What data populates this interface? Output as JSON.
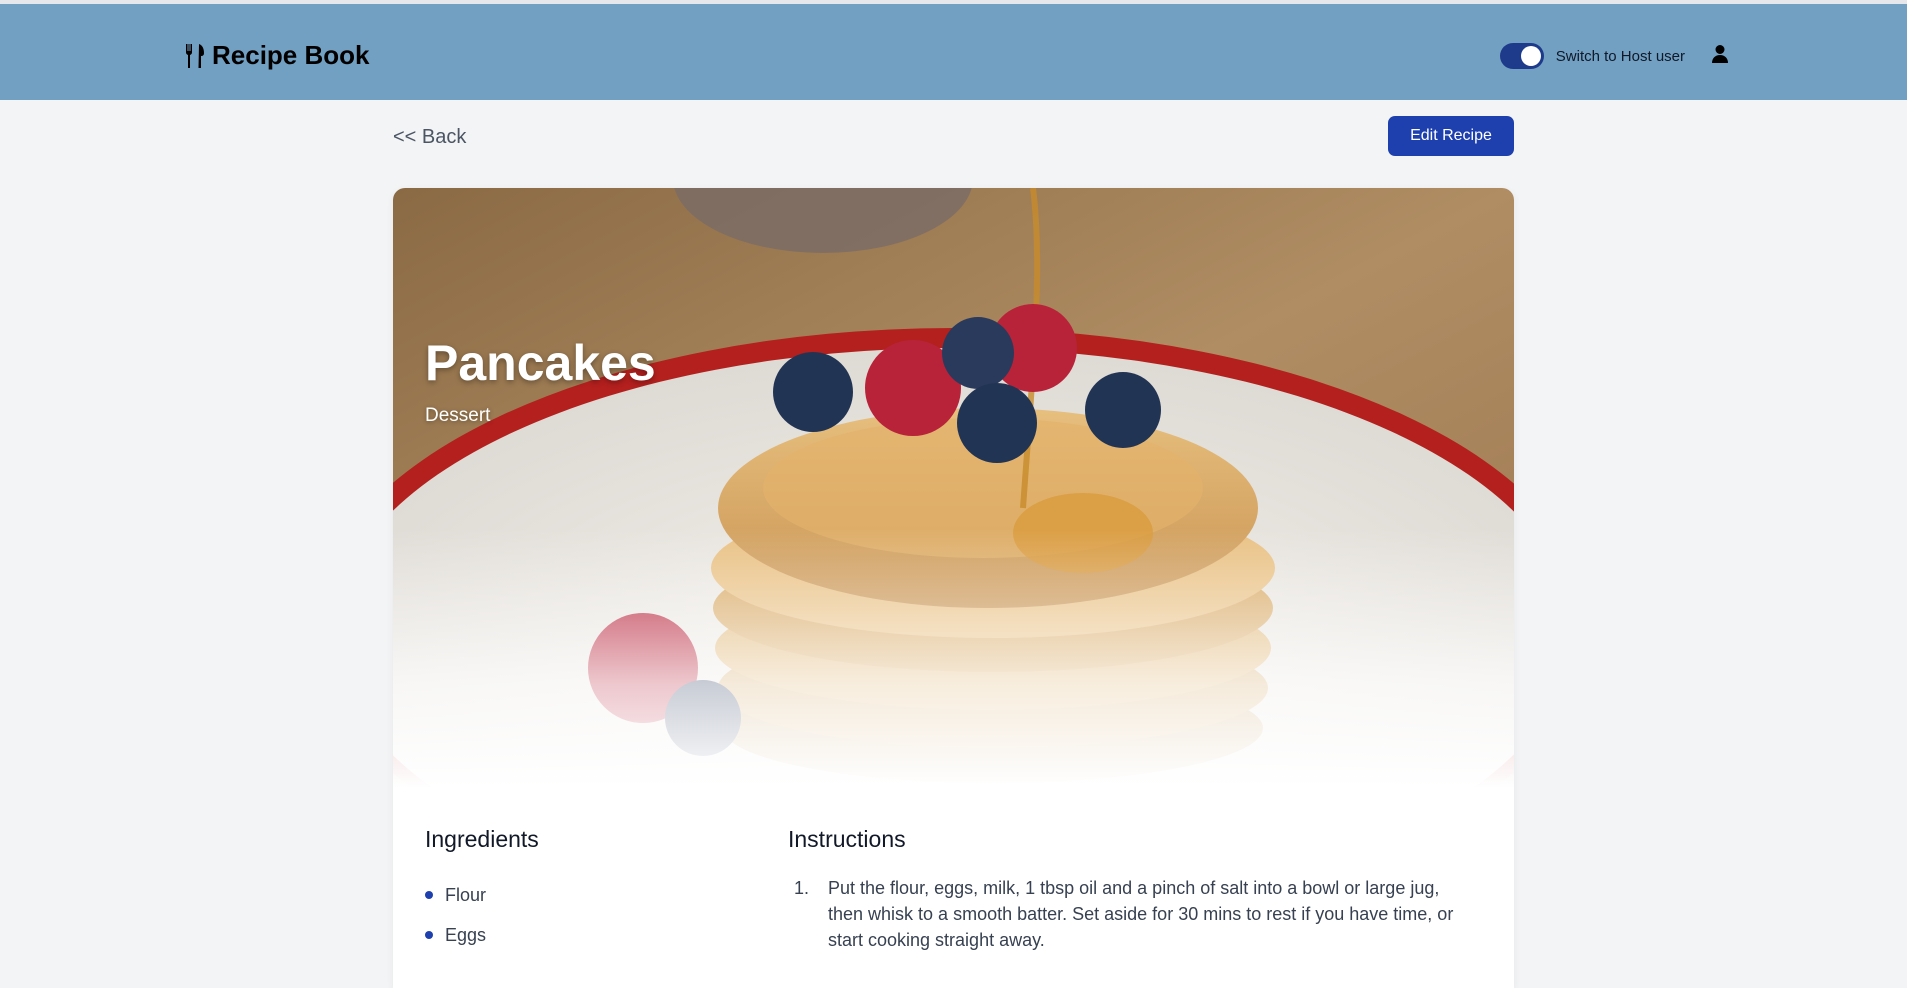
{
  "header": {
    "brand": "Recipe Book",
    "toggle_label": "Switch to Host user",
    "toggle_on": true
  },
  "toolbar": {
    "back_label": "<< Back",
    "edit_label": "Edit Recipe"
  },
  "recipe": {
    "title": "Pancakes",
    "category": "Dessert",
    "ingredients_heading": "Ingredients",
    "ingredients": [
      "Flour",
      "Eggs"
    ],
    "instructions_heading": "Instructions",
    "steps": [
      {
        "number": "1.",
        "text": "Put the flour, eggs, milk, 1 tbsp oil and a pinch of salt into a bowl or large jug, then whisk to a smooth batter. Set aside for 30 mins to rest if you have time, or start cooking straight away."
      }
    ]
  },
  "colors": {
    "header_bg": "#71a0c3",
    "accent": "#1e40af",
    "page_bg": "#f3f4f6"
  },
  "icons": [
    "fork-knife-icon",
    "user-icon"
  ]
}
